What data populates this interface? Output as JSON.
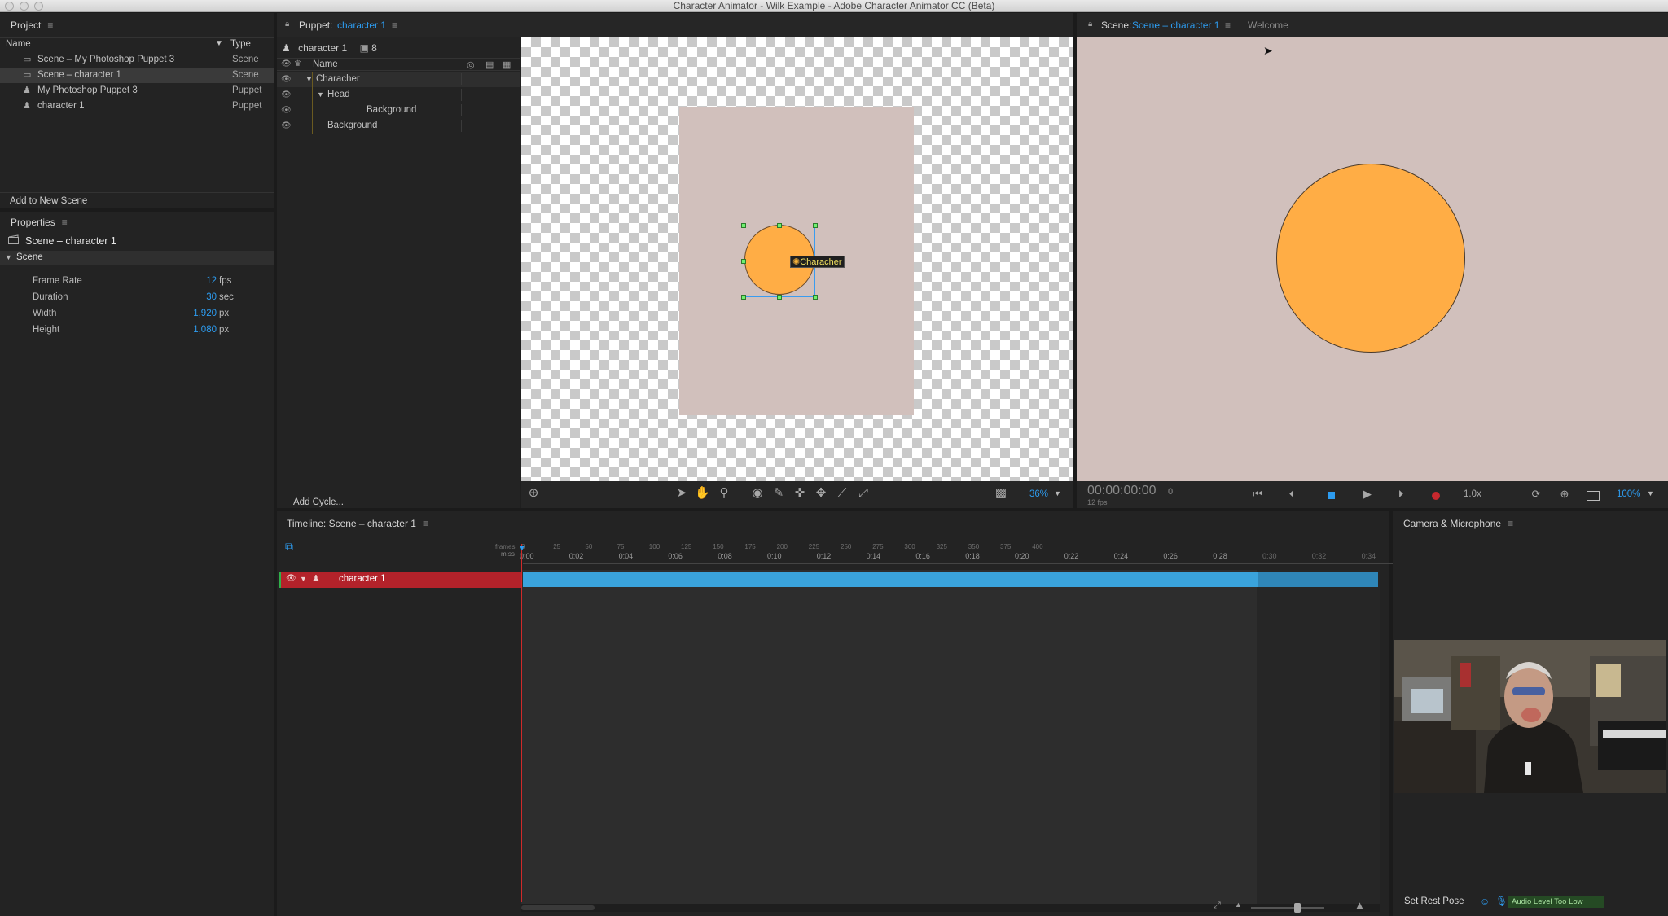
{
  "window": {
    "title": "Character Animator - Wilk Example - Adobe Character Animator CC (Beta)"
  },
  "project": {
    "title": "Project",
    "col_name": "Name",
    "col_type": "Type",
    "items": [
      {
        "name": "Scene – My Photoshop Puppet 3",
        "type": "Scene",
        "icon": "scene-icon"
      },
      {
        "name": "Scene – character 1",
        "type": "Scene",
        "icon": "scene-icon",
        "selected": true
      },
      {
        "name": "My Photoshop Puppet 3",
        "type": "Puppet",
        "icon": "puppet-icon"
      },
      {
        "name": "character 1",
        "type": "Puppet",
        "icon": "puppet-icon"
      }
    ],
    "add_button": "Add to New Scene"
  },
  "properties": {
    "title": "Properties",
    "object_name": "Scene – character 1",
    "section": "Scene",
    "rows": [
      {
        "label": "Frame Rate",
        "value": "12",
        "unit": "fps"
      },
      {
        "label": "Duration",
        "value": "30",
        "unit": "sec"
      },
      {
        "label": "Width",
        "value": "1,920",
        "unit": "px"
      },
      {
        "label": "Height",
        "value": "1,080",
        "unit": "px"
      }
    ]
  },
  "puppet": {
    "tab_prefix": "Puppet:",
    "tab_name": "character 1",
    "puppet_name": "character 1",
    "count": "8",
    "col_name": "Name",
    "layers": [
      {
        "name": "Characher",
        "expanded": true
      },
      {
        "name": "Head",
        "expanded": true
      },
      {
        "name": "Background",
        "expanded": false
      },
      {
        "name": "Background",
        "expanded": false
      }
    ],
    "add_cycle": "Add Cycle...",
    "handle_label": "Characher",
    "zoom": "36%"
  },
  "scene": {
    "tab_prefix": "Scene:",
    "tab_name": "Scene – character 1",
    "welcome_tab": "Welcome",
    "timecode": "00:00:00:00",
    "frame": "0",
    "fps": "12 fps",
    "speed": "1.0x",
    "zoom": "100%",
    "bg_color": "#d1c0bc",
    "circle_color": "#ffad45"
  },
  "timeline": {
    "title": "Timeline: Scene – character 1",
    "frames_label": "frames",
    "mss_label": "m:ss",
    "frame_ticks": [
      "0",
      "25",
      "50",
      "75",
      "100",
      "125",
      "150",
      "175",
      "200",
      "225",
      "250",
      "275",
      "300",
      "325",
      "350",
      "375",
      "400"
    ],
    "time_ticks": [
      "0:00",
      "0:02",
      "0:04",
      "0:06",
      "0:08",
      "0:10",
      "0:12",
      "0:14",
      "0:16",
      "0:18",
      "0:20",
      "0:22",
      "0:24",
      "0:26",
      "0:28",
      "0:30",
      "0:32",
      "0:34"
    ],
    "track_name": "character 1",
    "track_color": "#b3222a",
    "bar_color": "#3aa3dc"
  },
  "camera": {
    "title": "Camera & Microphone",
    "set_rest_pose": "Set Rest Pose",
    "audio_status": "Audio Level Too Low"
  }
}
